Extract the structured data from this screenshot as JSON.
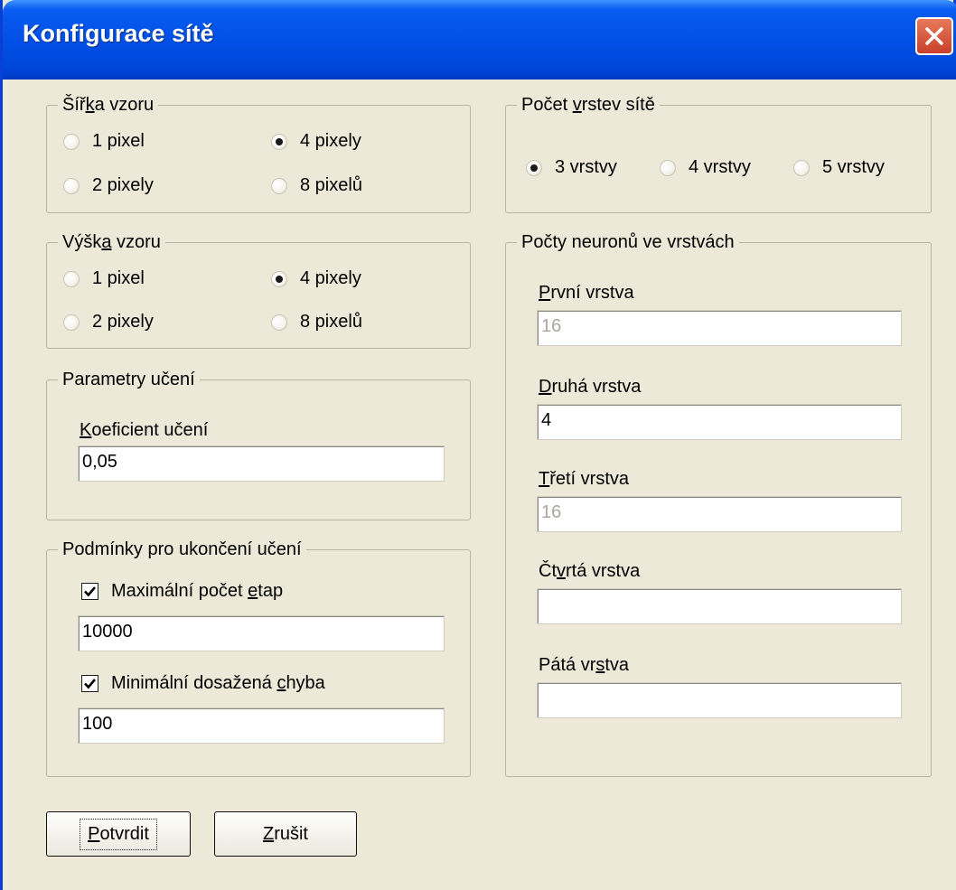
{
  "window": {
    "title": "Konfigurace sítě",
    "close_icon": "close-icon"
  },
  "sirka": {
    "legend_pre": "Šíř",
    "legend_ul": "k",
    "legend_post": "a vzoru",
    "options": [
      "1 pixel",
      "2 pixely",
      "4 pixely",
      "8 pixelů"
    ],
    "selected": "4 pixely"
  },
  "vyska": {
    "legend_pre": "Výšk",
    "legend_ul": "a",
    "legend_post": " vzoru",
    "options": [
      "1 pixel",
      "2 pixely",
      "4 pixely",
      "8 pixelů"
    ],
    "selected": "4 pixely"
  },
  "parametry": {
    "legend": "Parametry učení",
    "koef_label_ul": "K",
    "koef_label_post": "oeficient učení",
    "koef_value": "0,05"
  },
  "podminky": {
    "legend": "Podmínky pro ukončení učení",
    "max_pre": "Maximální počet ",
    "max_ul": "e",
    "max_post": "tap",
    "max_checked": true,
    "max_value": "10000",
    "min_pre": "Minimální dosažená ",
    "min_ul": "c",
    "min_post": "hyba",
    "min_checked": true,
    "min_value": "100"
  },
  "vrstvy": {
    "legend_pre": "Počet ",
    "legend_ul": "v",
    "legend_post": "rstev sítě",
    "options": [
      "3 vrstvy",
      "4 vrstvy",
      "5 vrstvy"
    ],
    "selected": "3 vrstvy"
  },
  "neurony": {
    "legend": "Počty neuronů ve vrstvách",
    "layers": [
      {
        "pre": "",
        "ul": "P",
        "post": "rvní vrstva",
        "value": "16",
        "enabled": false
      },
      {
        "pre": "",
        "ul": "D",
        "post": "ruhá vrstva",
        "value": "4",
        "enabled": true
      },
      {
        "pre": "",
        "ul": "T",
        "post": "řetí vrstva",
        "value": "16",
        "enabled": false
      },
      {
        "pre": "Čt",
        "ul": "v",
        "post": "rtá vrstva",
        "value": "",
        "enabled": true
      },
      {
        "pre": "Pátá vr",
        "ul": "s",
        "post": "tva",
        "value": "",
        "enabled": true
      }
    ]
  },
  "buttons": {
    "confirm_ul": "P",
    "confirm_post": "otvrdit",
    "cancel_ul": "Z",
    "cancel_post": "rušit"
  },
  "colors": {
    "titlebar": "#0050e6",
    "window_bg": "#ece9d8",
    "close": "#d5503a"
  }
}
